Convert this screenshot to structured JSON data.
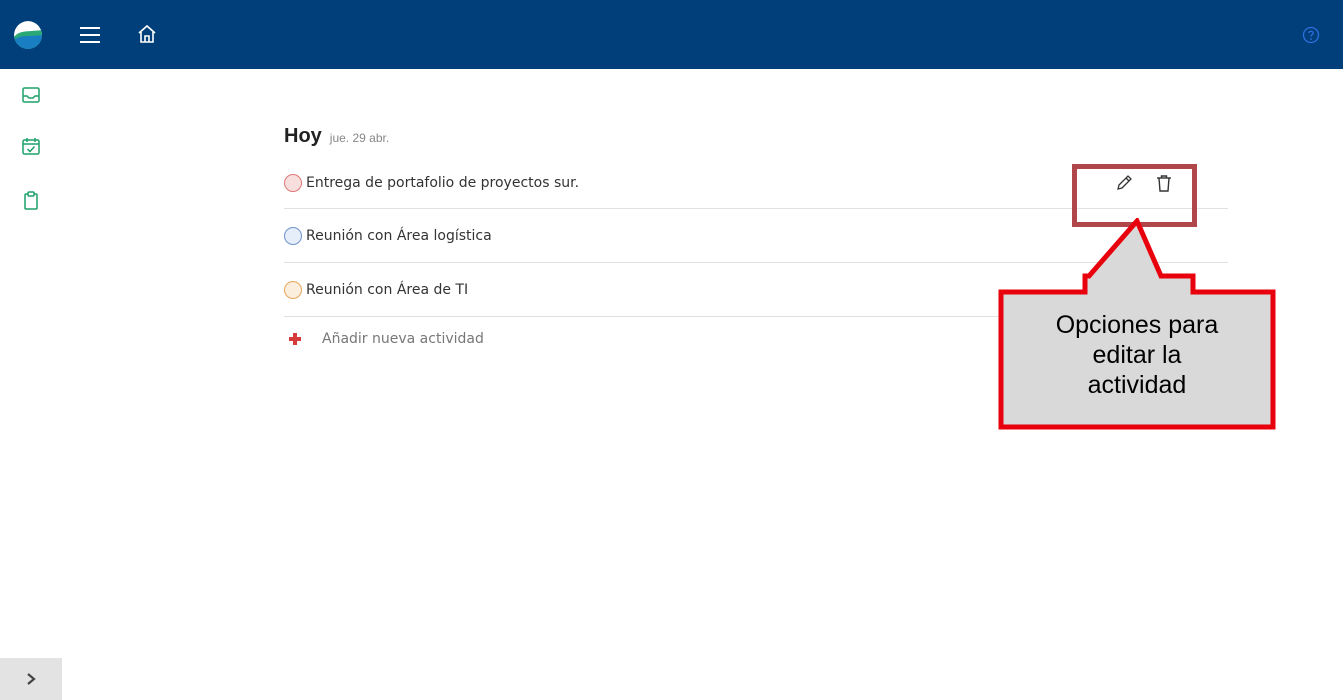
{
  "app": {
    "icons": {
      "menu": "hamburger-icon",
      "home": "home-icon",
      "help": "help-circle-icon"
    }
  },
  "sidebar": {
    "items": [
      {
        "icon": "inbox-icon"
      },
      {
        "icon": "calendar-check-icon"
      },
      {
        "icon": "clipboard-icon"
      }
    ],
    "collapse_icon": "chevron-right-icon"
  },
  "main": {
    "title": "Hoy",
    "date": "jue. 29 abr.",
    "tasks": [
      {
        "label": "Entrega de portafolio de proyectos sur.",
        "color": "#e07777",
        "fill": "#f9dede"
      },
      {
        "label": "Reunión con Área logística",
        "color": "#6f93c9",
        "fill": "#e6eef9"
      },
      {
        "label": "Reunión con Área de TI",
        "color": "#e8a55c",
        "fill": "#fbeedd"
      }
    ],
    "add_label": "Añadir nueva actividad",
    "actions": {
      "edit_icon": "pencil-icon",
      "delete_icon": "trash-icon"
    }
  },
  "annotation": {
    "text_lines": [
      "Opciones para",
      "editar la",
      "actividad"
    ],
    "border_color": "#e8000d",
    "box_color": "#b0454a",
    "fill_color": "#d9d9d9"
  },
  "colors": {
    "topbar": "#003f7a",
    "accent_green": "#1ea06a"
  }
}
